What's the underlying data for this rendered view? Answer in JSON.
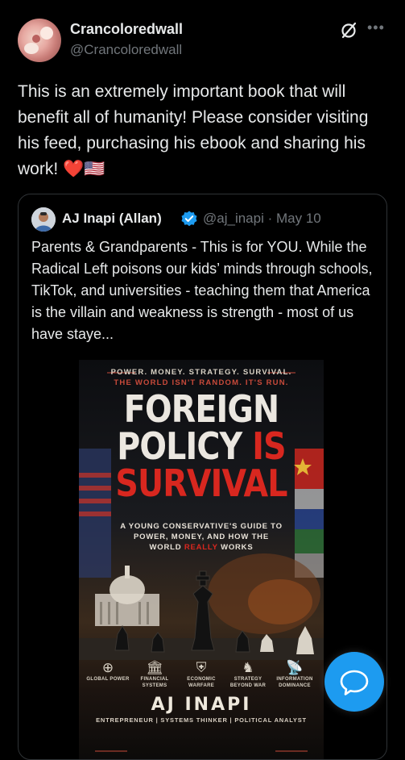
{
  "post": {
    "author_name": "Crancoloredwall",
    "author_handle": "@Crancoloredwall",
    "text": "This is an extremely important book that will benefit all of humanity! Please consider visiting his feed, purchasing his ebook and sharing his work! ❤️🇺🇸",
    "icons": {
      "grok": "grok-icon",
      "more": "more-icon"
    },
    "more_label": "•••"
  },
  "quote": {
    "author_name": "AJ Inapi (Allan)",
    "author_handle": "@aj_inapi",
    "separator": "·",
    "date": "May 10",
    "text": "Parents & Grandparents - This is for YOU. While the Radical Left poisons our kids’ minds through schools, TikTok, and universities - teaching them that America is the villain and weakness is strength - most of us have staye...",
    "verified_color": "#1d9bf0"
  },
  "book": {
    "tagline1": "POWER. MONEY. STRATEGY. SURVIVAL.",
    "tagline2": "THE WORLD ISN'T RANDOM. IT'S RUN.",
    "title_line1": "FOREIGN",
    "title_line2a": "POLICY",
    "title_line2b": "IS",
    "title_line3": "SURVIVAL",
    "subtitle_a": "A YOUNG CONSERVATIVE'S GUIDE TO POWER, MONEY, AND HOW THE WORLD",
    "subtitle_hl": "REALLY",
    "subtitle_b": "WORKS",
    "pillars": [
      {
        "icon": "globe-icon",
        "glyph": "⊕",
        "label": "GLOBAL POWER"
      },
      {
        "icon": "bank-icon",
        "glyph": "🏛",
        "label": "FINANCIAL SYSTEMS"
      },
      {
        "icon": "shield-icon",
        "glyph": "⛨",
        "label": "ECONOMIC WARFARE"
      },
      {
        "icon": "chess-piece-icon",
        "glyph": "♞",
        "label": "STRATEGY BEYOND WAR"
      },
      {
        "icon": "satellite-icon",
        "glyph": "📡",
        "label": "INFORMATION DOMINANCE"
      }
    ],
    "author": "AJ INAPI",
    "roles": "ENTREPRENEUR  |  SYSTEMS THINKER  |  POLITICAL ANALYST"
  },
  "fab": {
    "icon": "chat-bubble-icon",
    "color": "#1d9bf0"
  }
}
